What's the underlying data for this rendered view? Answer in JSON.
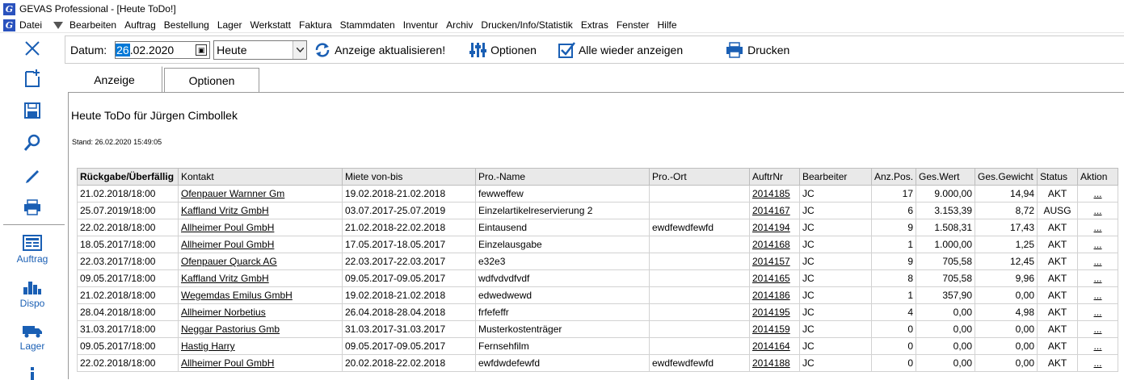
{
  "window": {
    "title": "GEVAS Professional - [Heute ToDo!]",
    "app_icon": "G"
  },
  "menu": [
    "Datei",
    "Bearbeiten",
    "Auftrag",
    "Bestellung",
    "Lager",
    "Werkstatt",
    "Faktura",
    "Stammdaten",
    "Inventur",
    "Archiv",
    "Drucken/Info/Statistik",
    "Extras",
    "Fenster",
    "Hilfe"
  ],
  "sidebar": {
    "labels": {
      "auftrag": "Auftrag",
      "dispo": "Dispo",
      "lager": "Lager"
    },
    "accent": "#1a5fb4"
  },
  "toolbar": {
    "date_label": "Datum:",
    "date_selected": "26",
    "date_rest": ".02.2020",
    "period_value": "Heute",
    "refresh_label": "Anzeige aktualisieren!",
    "options_label": "Optionen",
    "show_all_label": "Alle wieder anzeigen",
    "print_label": "Drucken"
  },
  "tabs": {
    "display": "Anzeige",
    "options": "Optionen"
  },
  "report": {
    "title": "Heute ToDo für Jürgen Cimbollek",
    "stand": "Stand: 26.02.2020 15:49:05"
  },
  "table": {
    "headers": [
      "Rückgabe/Überfällig",
      "Kontakt",
      "Miete von-bis",
      "Pro.-Name",
      "Pro.-Ort",
      "AuftrNr",
      "Bearbeiter",
      "Anz.Pos.",
      "Ges.Wert",
      "Ges.Gewicht",
      "Status",
      "Aktion"
    ],
    "rows": [
      [
        "21.02.2018/18:00",
        "Ofenpauer Warnner Gm",
        "19.02.2018-21.02.2018",
        "fewweffew",
        "",
        "2014185",
        "JC",
        "17",
        "9.000,00",
        "14,94",
        "AKT",
        "..."
      ],
      [
        "25.07.2019/18:00",
        "Kaffland Vritz GmbH",
        "03.07.2017-25.07.2019",
        "Einzelartikelreservierung 2",
        "",
        "2014167",
        "JC",
        "6",
        "3.153,39",
        "8,72",
        "AUSG",
        "..."
      ],
      [
        "22.02.2018/18:00",
        "Allheimer Poul GmbH",
        "21.02.2018-22.02.2018",
        "Eintausend",
        "ewdfewdfewfd",
        "2014194",
        "JC",
        "9",
        "1.508,31",
        "17,43",
        "AKT",
        "..."
      ],
      [
        "18.05.2017/18:00",
        "Allheimer Poul GmbH",
        "17.05.2017-18.05.2017",
        "Einzelausgabe",
        "",
        "2014168",
        "JC",
        "1",
        "1.000,00",
        "1,25",
        "AKT",
        "..."
      ],
      [
        "22.03.2017/18:00",
        "Ofenpauer Quarck AG",
        "22.03.2017-22.03.2017",
        "e32e3",
        "",
        "2014157",
        "JC",
        "9",
        "705,58",
        "12,45",
        "AKT",
        "..."
      ],
      [
        "09.05.2017/18:00",
        "Kaffland Vritz GmbH",
        "09.05.2017-09.05.2017",
        "wdfvdvdfvdf",
        "",
        "2014165",
        "JC",
        "8",
        "705,58",
        "9,96",
        "AKT",
        "..."
      ],
      [
        "21.02.2018/18:00",
        "Wegemdas Emilus GmbH",
        "19.02.2018-21.02.2018",
        "edwedwewd",
        "",
        "2014186",
        "JC",
        "1",
        "357,90",
        "0,00",
        "AKT",
        "..."
      ],
      [
        "28.04.2018/18:00",
        "Allheimer Norbetius",
        "26.04.2018-28.04.2018",
        "frfefeffr",
        "",
        "2014195",
        "JC",
        "4",
        "0,00",
        "4,98",
        "AKT",
        "..."
      ],
      [
        "31.03.2017/18:00",
        "Neggar Pastorius Gmb",
        "31.03.2017-31.03.2017",
        "Musterkostenträger",
        "",
        "2014159",
        "JC",
        "0",
        "0,00",
        "0,00",
        "AKT",
        "..."
      ],
      [
        "09.05.2017/18:00",
        "Hastig Harry",
        "09.05.2017-09.05.2017",
        "Fernsehfilm",
        "",
        "2014164",
        "JC",
        "0",
        "0,00",
        "0,00",
        "AKT",
        "..."
      ],
      [
        "22.02.2018/18:00",
        "Allheimer Poul GmbH",
        "20.02.2018-22.02.2018",
        "ewfdwdefewfd",
        "ewdfewdfewfd",
        "2014188",
        "JC",
        "0",
        "0,00",
        "0,00",
        "AKT",
        "..."
      ]
    ]
  }
}
